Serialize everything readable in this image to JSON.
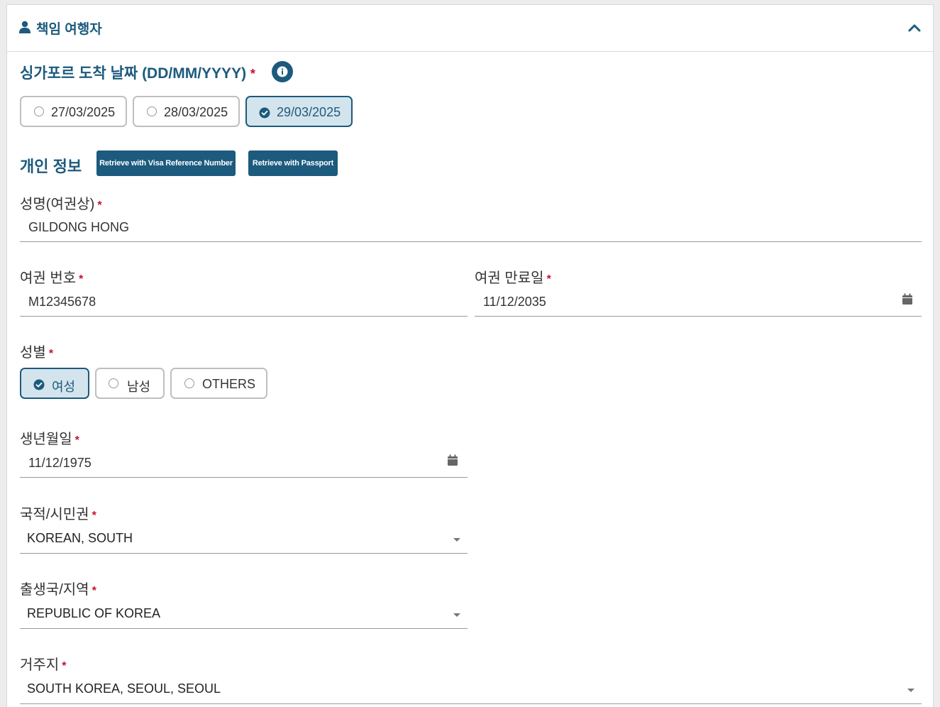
{
  "header": {
    "title": "책임 여행자",
    "user_icon": "user-icon",
    "collapse_icon": "chevron-up-icon"
  },
  "arrival": {
    "label": "싱가포르 도착 날짜 (DD/MM/YYYY)",
    "required_mark": "*",
    "info_icon": "info-icon",
    "options": [
      {
        "label": "27/03/2025",
        "selected": false
      },
      {
        "label": "28/03/2025",
        "selected": false
      },
      {
        "label": "29/03/2025",
        "selected": true
      }
    ]
  },
  "personal": {
    "title": "개인 정보",
    "retrieve_visa_label": "Retrieve with Visa Reference Number",
    "retrieve_passport_label": "Retrieve with Passport"
  },
  "fields": {
    "name": {
      "label": "성명(여권상)",
      "value": "GILDONG HONG"
    },
    "passport_no": {
      "label": "여권 번호",
      "value": "M12345678"
    },
    "passport_expiry": {
      "label": "여권 만료일",
      "value": "11/12/2035"
    },
    "gender": {
      "label": "성별",
      "options": [
        {
          "label": "여성",
          "selected": true
        },
        {
          "label": "남성",
          "selected": false
        },
        {
          "label": "OTHERS",
          "selected": false
        }
      ]
    },
    "dob": {
      "label": "생년월일",
      "value": "11/12/1975"
    },
    "nationality": {
      "label": "국적/시민권",
      "value": "KOREAN, SOUTH"
    },
    "birth_country": {
      "label": "출생국/지역",
      "value": "REPUBLIC OF KOREA"
    },
    "residence": {
      "label": "거주지",
      "value": "SOUTH KOREA, SEOUL, SEOUL"
    }
  },
  "required_mark": "*",
  "colors": {
    "primary": "#1c5a7e",
    "required": "#c8102e",
    "selected_bg": "#d4e4ec"
  }
}
